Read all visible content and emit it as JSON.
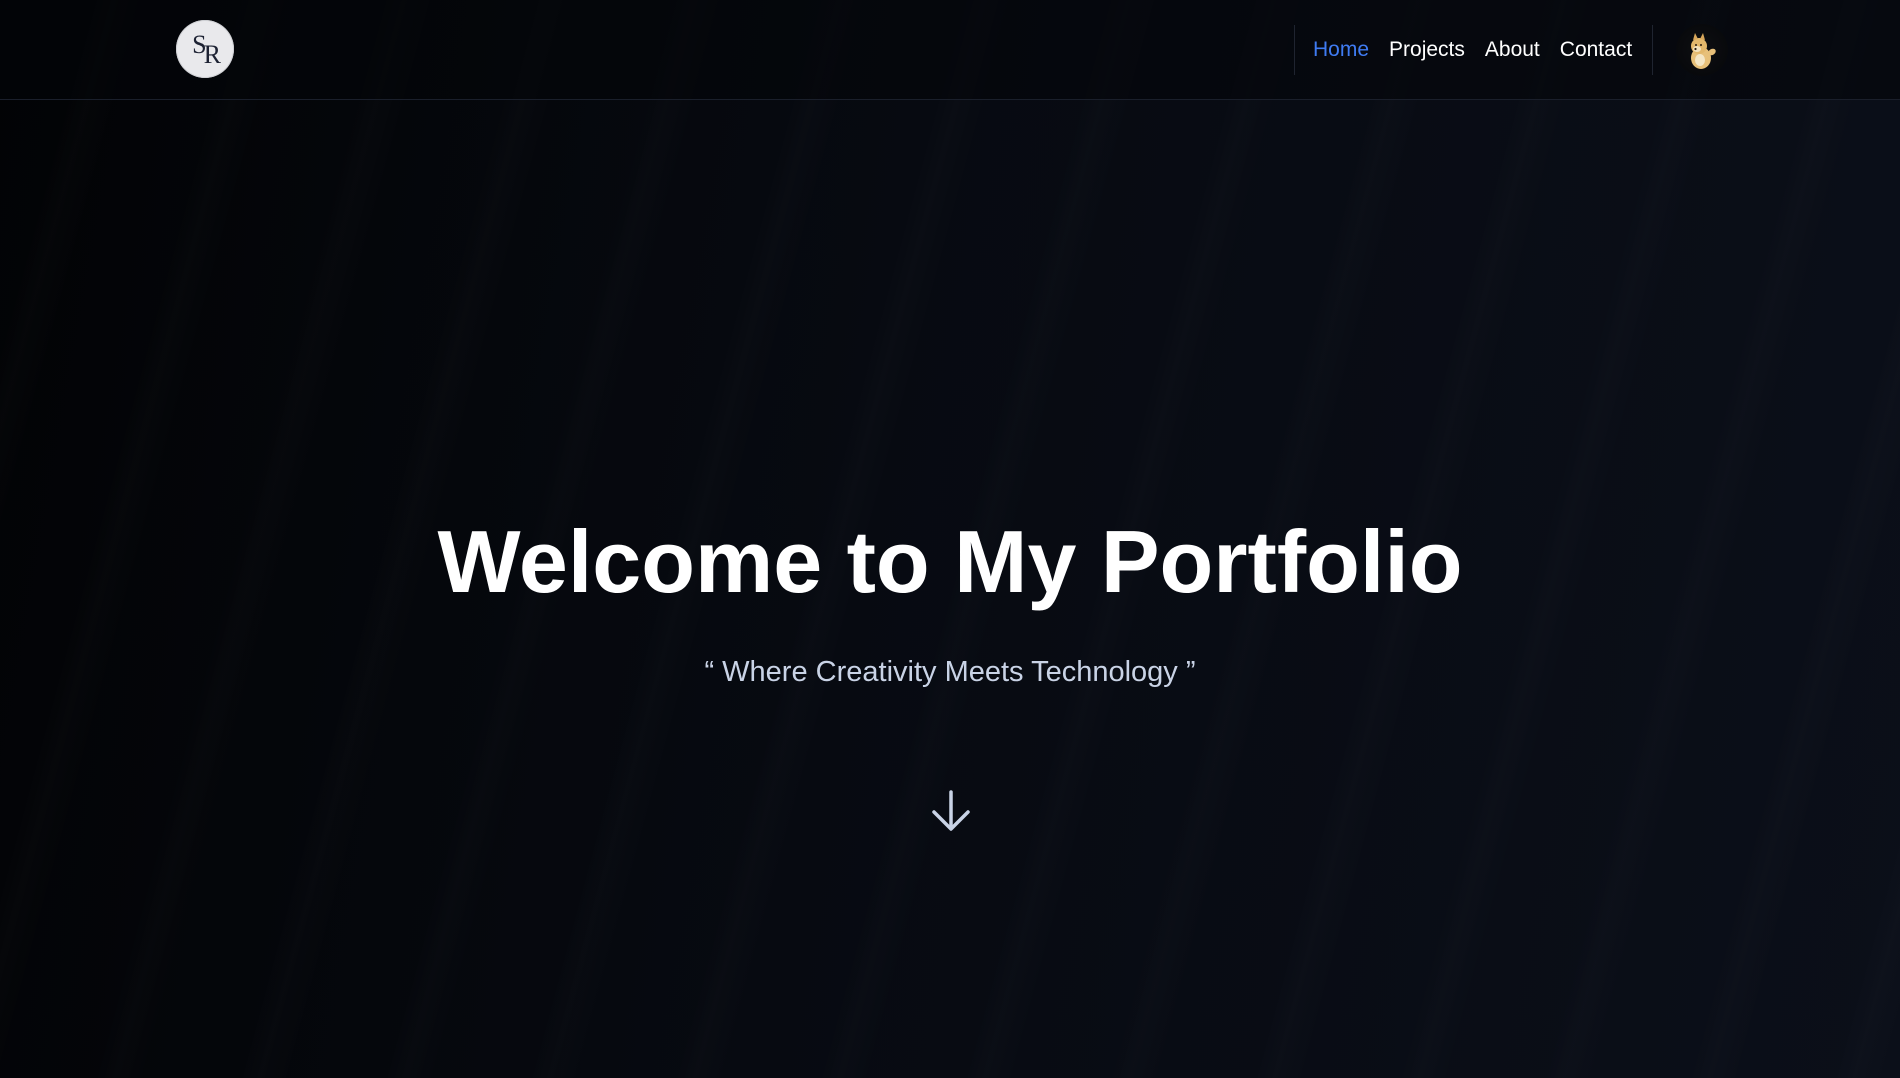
{
  "header": {
    "logo_text_top": "S",
    "logo_text_bottom": "R",
    "nav": {
      "items": [
        {
          "label": "Home",
          "active": true
        },
        {
          "label": "Projects",
          "active": false
        },
        {
          "label": "About",
          "active": false
        },
        {
          "label": "Contact",
          "active": false
        }
      ]
    },
    "avatar_icon": "doge-avatar-icon"
  },
  "hero": {
    "title": "Welcome to My Portfolio",
    "subtitle": "“ Where Creativity Meets Technology ”",
    "scroll_icon": "arrow-down-icon"
  },
  "colors": {
    "background": "#06080d",
    "text": "#ffffff",
    "subtitle": "#c9d3e6",
    "accent_active_nav": "#3f7bf2"
  }
}
